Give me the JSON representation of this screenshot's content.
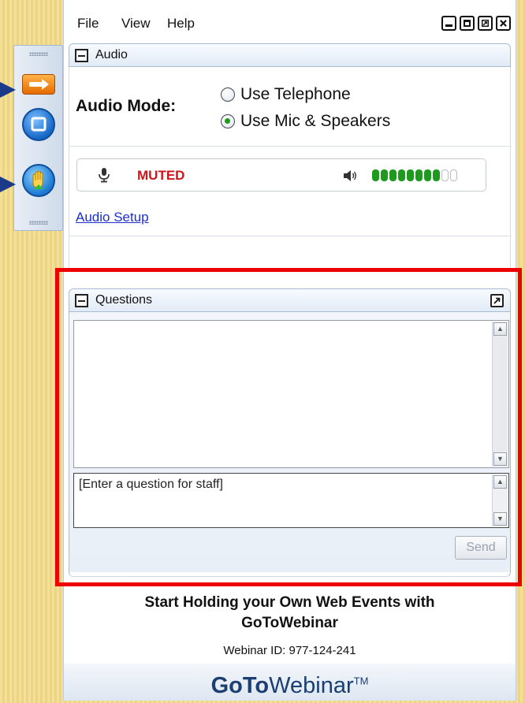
{
  "menu": {
    "items": [
      "File",
      "View",
      "Help"
    ]
  },
  "window_controls": [
    "minimize-icon",
    "restore-icon",
    "popout-icon",
    "close-icon"
  ],
  "audio_panel": {
    "title": "Audio",
    "mode_label": "Audio Mode:",
    "options": [
      {
        "label": "Use Telephone",
        "selected": false
      },
      {
        "label": "Use Mic & Speakers",
        "selected": true
      }
    ],
    "mic_status": "MUTED",
    "speaker_level": {
      "filled": 8,
      "total": 10
    },
    "setup_link": "Audio Setup"
  },
  "questions_panel": {
    "title": "Questions",
    "input_text": "[Enter a question for staff]",
    "send_label": "Send"
  },
  "footer": {
    "promo_line1": "Start Holding your Own Web Events with",
    "promo_line2": "GoToWebinar",
    "webinar_id": "Webinar ID: 977-124-241",
    "logo_bold": "GoTo",
    "logo_light": "Webinar",
    "logo_tm": "TM"
  },
  "colors": {
    "muted": "#d0161b",
    "meter_on": "#1e9b1e",
    "highlight": "#ee0000",
    "logo": "#1b3f73"
  }
}
